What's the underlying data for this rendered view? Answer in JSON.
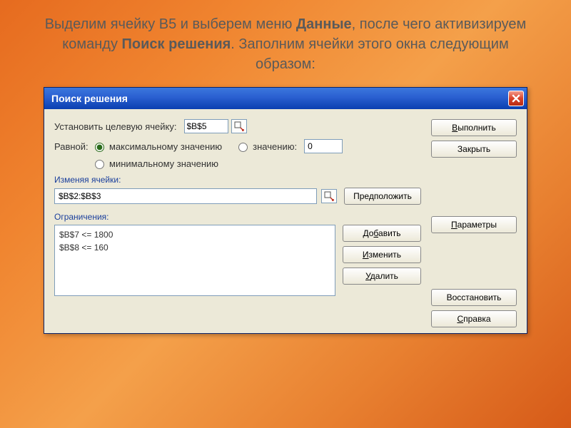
{
  "slide": {
    "pre1": "Выделим ячейку В5 и выберем меню ",
    "bold1": "Данные",
    "mid1": ", после чего активизируем команду ",
    "bold2": "Поиск решения",
    "post1": ". Заполним ячейки этого окна следующим образом:"
  },
  "dialog": {
    "title": "Поиск решения",
    "target_label": "Установить целевую ячейку:",
    "target_value": "$B$5",
    "equal_label": "Равной:",
    "radio_max": "максимальному значению",
    "radio_val": "значению:",
    "radio_min": "минимальному значению",
    "value_field": "0",
    "changing_label": "Изменяя ячейки:",
    "changing_value": "$B$2:$B$3",
    "guess_btn": "Предположить",
    "constraints_label": "Ограничения:",
    "constraints": [
      "$B$7 <= 1800",
      "$B$8 <= 160"
    ],
    "add_btn_pre": "До",
    "add_btn_u": "б",
    "add_btn_post": "авить",
    "change_btn_u": "И",
    "change_btn_post": "зменить",
    "delete_btn_u": "У",
    "delete_btn_post": "далить",
    "execute_btn_u": "В",
    "execute_btn_post": "ыполнить",
    "close_btn": "Закрыть",
    "params_btn_u": "П",
    "params_btn_post": "араметры",
    "restore_btn": "Восстановить",
    "help_btn_u": "С",
    "help_btn_post": "правка"
  }
}
